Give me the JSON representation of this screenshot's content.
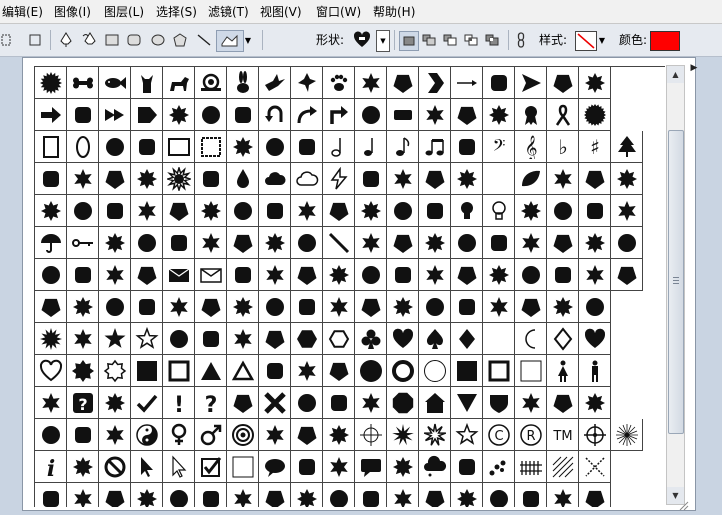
{
  "menubar": {
    "items": [
      "编辑(E)",
      "图像(I)",
      "图层(L)",
      "选择(S)",
      "滤镜(T)",
      "视图(V)",
      "窗口(W)",
      "帮助(H)"
    ]
  },
  "options": {
    "shape_label": "形状:",
    "style_label": "样式:",
    "color_label": "颜色:",
    "color_value": "#ff0000"
  },
  "shapes": {
    "grid": [
      [
        "sun-burst",
        "bone",
        "fish",
        "cat",
        "dog",
        "snail",
        "rabbit",
        "bird",
        "dove",
        "paw-print",
        "paw-print-2",
        "arrow-feather",
        "chevron",
        "arrow-thin",
        "arrow-long",
        "arrow-triangle",
        "arrow-bold-right",
        "arrow-feather-2"
      ],
      [
        "arrow-right",
        "arrow-right-2",
        "arrow-double",
        "pentagon-arrow",
        "arrow-curved-right",
        "arrow-wavy",
        "arrow-feather-3",
        "arrow-u-turn",
        "arrow-curved",
        "arrow-bend",
        "arrow-fletched",
        "banner",
        "banner-2",
        "banner-3",
        "bow-banner",
        "ribbon-award",
        "ribbon",
        "seal"
      ],
      [
        "frame-rect",
        "frame-oval",
        "frame-scroll",
        "frame-ornate",
        "frame-square",
        "frame-wavy",
        "frame-zigzag",
        "frame-stamp",
        "frame-eye",
        "note-half",
        "note-quarter",
        "note-eighth",
        "note-beamed",
        "note-sixteenth",
        "bass-clef",
        "treble-clef",
        "flat",
        "sharp",
        "tree"
      ],
      [
        "grass-leaf",
        "clover",
        "butterfly",
        "sun-swirl",
        "sun",
        "waves",
        "raindrop",
        "cloud",
        "cloud-outline",
        "lightning",
        "fire",
        "snowflake",
        "snowflake-2",
        "snowflake-3",
        "crescent",
        "leaf",
        "maple-leaf",
        "leaf-2",
        "leaf-3"
      ],
      [
        "maple-leaf-2",
        "leaf-4",
        "maple-leaf-3",
        "flower",
        "flower-2",
        "flower-3",
        "flower-4",
        "flower-5",
        "flower-6",
        "flower-7",
        "dots-grass",
        "grass",
        "grass-2",
        "light-bulb",
        "light-bulb-outline",
        "hand-right",
        "hand-left",
        "footprint",
        "footprint-2"
      ],
      [
        "umbrella",
        "key",
        "key-2",
        "bow",
        "puzzle",
        "puzzle-2",
        "puzzle-3",
        "puzzle-4",
        "pencil-line",
        "pencil",
        "pencil-2",
        "pencil-3",
        "pencil-4",
        "telephone",
        "telephone-2",
        "hourglass",
        "thumbtack",
        "star-of-david",
        "crown"
      ],
      [
        "queen",
        "crown-2",
        "crown-3",
        "crown-4",
        "envelope",
        "envelope-outline",
        "scissors",
        "scissors-2",
        "paperclip",
        "stamp",
        "blank-card",
        "tag",
        "christmas-tree",
        "holly",
        "flag",
        "hand-pointing",
        "card",
        "fleur-de-lis",
        "divider"
      ],
      [
        "ornament-square",
        "ornament-square-2",
        "ornament-diamond",
        "ornament-crown",
        "ornament-x",
        "ornament-flower",
        "ornament-frame",
        "knot",
        "swirl",
        "ornament-flower-2",
        "ornament-flower-3",
        "ornament-flower-4",
        "flower-8",
        "butterfly-2",
        "bird-2",
        "spiral",
        "zigzag",
        "spiral-2"
      ],
      [
        "starburst",
        "starburst-2",
        "star-5",
        "star-outline",
        "sun-badge",
        "sun-badge-2",
        "starburst-3",
        "starburst-4",
        "hexagon",
        "hexagon-outline",
        "club",
        "heart",
        "spade",
        "diamond",
        "crescent-2",
        "crescent-outline",
        "diamond-outline",
        "heart-2"
      ],
      [
        "heart-outline",
        "octagram",
        "octagram-outline",
        "square",
        "square-outline",
        "triangle",
        "triangle-outline",
        "puzzle-blob",
        "flower-blob",
        "flower-outline",
        "circle",
        "circle-outline",
        "circle-outline-2",
        "square-2",
        "square-outline-2",
        "square-outline-3",
        "woman",
        "man"
      ],
      [
        "airplane",
        "question-box",
        "phone-box",
        "checkmark",
        "exclamation",
        "question",
        "starburst-5",
        "x-mark",
        "walker",
        "couple",
        "wheelchair",
        "octagon",
        "home",
        "triangle-down",
        "shield",
        "shield-2",
        "car",
        "car-2"
      ],
      [
        "bicycle",
        "recycle-outline",
        "recycle",
        "yin-yang",
        "female",
        "male",
        "target",
        "radiation",
        "atom",
        "globe",
        "crosshair",
        "splat",
        "splat-outline",
        "star-outline-2",
        "copyright",
        "registered",
        "trademark",
        "crosshair-2",
        "sun-lines"
      ],
      [
        "info",
        "campfire",
        "no-symbol",
        "cursor",
        "cursor-outline",
        "checkbox",
        "square-blank",
        "speech-bubble",
        "speech-bubble-2",
        "speech-bubble-3",
        "speech-box",
        "speech-box-2",
        "thought-bubble",
        "thought-bubble-2",
        "dots-trail",
        "fence",
        "hatch",
        "x-dotted"
      ],
      [
        "grid-1",
        "grid-2",
        "grid-3",
        "grid-4",
        "grid-5",
        "grid-6",
        "grid-7",
        "grid-8",
        "grid-9",
        "grid-10",
        "grid-11",
        "grid-12",
        "grid-13",
        "grid-14",
        "grid-15",
        "grid-16",
        "grid-17",
        "grid-18"
      ]
    ]
  }
}
